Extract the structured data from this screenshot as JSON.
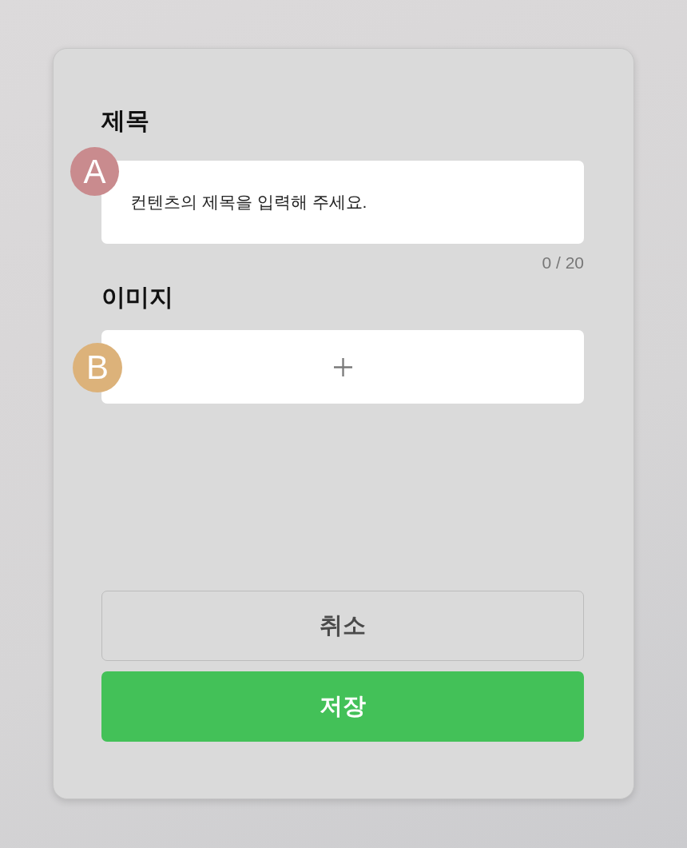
{
  "fields": [
    {
      "kind": "text",
      "label": "제목",
      "placeholder": "컨텐츠의 제목을 입력해 주세요.",
      "counter": "0 / 20",
      "marker": {
        "label": "A",
        "color": "#c98b8e"
      }
    },
    {
      "kind": "image",
      "label": "이미지",
      "marker": {
        "label": "B",
        "color": "#dcb27a"
      }
    }
  ],
  "buttons": [
    {
      "kind": "secondary",
      "label": "취소"
    },
    {
      "kind": "primary",
      "label": "저장"
    }
  ]
}
